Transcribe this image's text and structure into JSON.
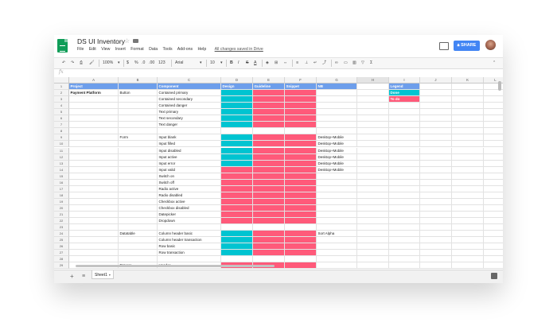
{
  "window": {
    "title": "DS UI Inventory",
    "menus": [
      "File",
      "Edit",
      "View",
      "Insert",
      "Format",
      "Data",
      "Tools",
      "Add-ons",
      "Help"
    ],
    "save_status": "All changes saved in Drive",
    "share_label": "SHARE"
  },
  "toolbar": {
    "zoom": "100%",
    "currency": "$",
    "percent": "%",
    "decimal_less": ".0",
    "decimal_more": ".00",
    "number_format": "123",
    "font": "Arial",
    "font_size": "10",
    "bold": "B",
    "italic": "I",
    "strike": "S",
    "text_color": "A"
  },
  "formula_bar": {
    "fx": "fx",
    "value": ""
  },
  "colors": {
    "teal": "#00c4d1",
    "pink": "#ff5a7a",
    "header_blue": "#6d9eeb",
    "share_blue": "#4285f4"
  },
  "columns": [
    "A",
    "B",
    "C",
    "D",
    "E",
    "F",
    "G",
    "H",
    "I",
    "J",
    "K",
    "L"
  ],
  "rows": [
    {
      "n": "1",
      "A": "Project",
      "B": "",
      "C": "Component",
      "D": "Design",
      "E": "Guideline",
      "F": "Snippet",
      "G": "NB",
      "I": "Legend",
      "hdr": true
    },
    {
      "n": "2",
      "A": "Payment Platform",
      "B": "Button",
      "C": "Contained primary",
      "G": "",
      "I": "Done",
      "d": "teal",
      "e": "pink",
      "f": "pink"
    },
    {
      "n": "3",
      "A": "",
      "B": "",
      "C": "Contained secondary",
      "I": "To do",
      "d": "teal",
      "e": "pink",
      "f": "pink"
    },
    {
      "n": "4",
      "C": "Contained danger",
      "d": "teal",
      "e": "pink",
      "f": "pink"
    },
    {
      "n": "5",
      "C": "Text primary",
      "d": "teal",
      "e": "pink",
      "f": "pink"
    },
    {
      "n": "6",
      "C": "Text secondary",
      "d": "teal",
      "e": "pink",
      "f": "pink"
    },
    {
      "n": "7",
      "C": "Text danger",
      "d": "teal",
      "e": "pink",
      "f": "pink"
    },
    {
      "n": "8",
      "C": ""
    },
    {
      "n": "9",
      "B": "Form",
      "C": "Input blank",
      "G": "Desktop+Mobile",
      "d": "teal",
      "e": "pink",
      "f": "pink"
    },
    {
      "n": "10",
      "C": "Input filled",
      "G": "Desktop+Mobile",
      "d": "teal",
      "e": "pink",
      "f": "pink"
    },
    {
      "n": "11",
      "C": "Input disabled",
      "G": "Desktop+Mobile",
      "d": "teal",
      "e": "pink",
      "f": "pink"
    },
    {
      "n": "12",
      "C": "Input active",
      "G": "Desktop+Mobile",
      "d": "teal",
      "e": "pink",
      "f": "pink"
    },
    {
      "n": "13",
      "C": "Input error",
      "G": "Desktop+Mobile",
      "d": "teal",
      "e": "pink",
      "f": "pink"
    },
    {
      "n": "14",
      "C": "Input valid",
      "G": "Desktop+Mobile",
      "d": "pink",
      "e": "pink",
      "f": "pink"
    },
    {
      "n": "15",
      "C": "Switch on",
      "d": "pink",
      "e": "pink",
      "f": "pink"
    },
    {
      "n": "16",
      "C": "Switch off",
      "d": "pink",
      "e": "pink",
      "f": "pink"
    },
    {
      "n": "17",
      "C": "Radio active",
      "d": "pink",
      "e": "pink",
      "f": "pink"
    },
    {
      "n": "18",
      "C": "Radio disabled",
      "d": "pink",
      "e": "pink",
      "f": "pink"
    },
    {
      "n": "19",
      "C": "Checkbox active",
      "d": "pink",
      "e": "pink",
      "f": "pink"
    },
    {
      "n": "20",
      "C": "Checkbox disabled",
      "d": "pink",
      "e": "pink",
      "f": "pink"
    },
    {
      "n": "21",
      "C": "Datepicker",
      "d": "pink",
      "e": "pink",
      "f": "pink"
    },
    {
      "n": "22",
      "C": "Dropdown",
      "d": "pink",
      "e": "pink",
      "f": "pink"
    },
    {
      "n": "23",
      "C": ""
    },
    {
      "n": "24",
      "B": "Datatable",
      "C": "Column header basic",
      "G": "Sort Alpha",
      "d": "teal",
      "e": "pink",
      "f": "pink"
    },
    {
      "n": "25",
      "C": "Column header transaction",
      "d": "teal",
      "e": "pink",
      "f": "pink"
    },
    {
      "n": "26",
      "C": "Row basic",
      "d": "teal",
      "e": "pink",
      "f": "pink"
    },
    {
      "n": "27",
      "C": "Row transaction",
      "d": "teal",
      "e": "pink",
      "f": "pink"
    },
    {
      "n": "28",
      "C": ""
    },
    {
      "n": "29",
      "B": "Drawer",
      "C": "Header",
      "d": "pink",
      "e": "pink",
      "f": "pink"
    }
  ],
  "sheet": {
    "tab": "Sheet1"
  }
}
